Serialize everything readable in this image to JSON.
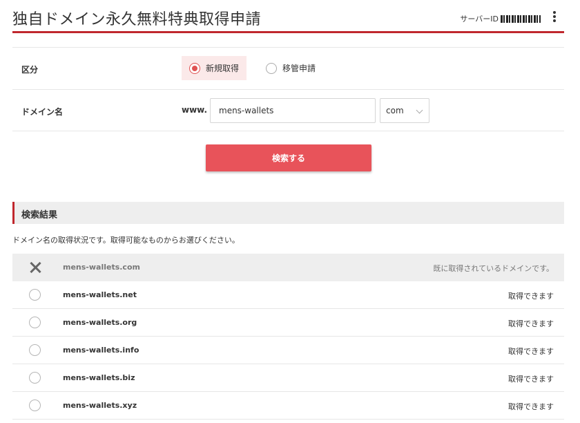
{
  "header": {
    "title": "独自ドメイン永久無料特典取得申請",
    "server_id_label": "サーバーID"
  },
  "form": {
    "type_label": "区分",
    "type_options": [
      {
        "label": "新規取得",
        "selected": true
      },
      {
        "label": "移管申請",
        "selected": false
      }
    ],
    "domain_label": "ドメイン名",
    "www_prefix": "www.",
    "domain_value": "mens-wallets",
    "tld_value": "com",
    "search_button": "検索する"
  },
  "results": {
    "title": "検索結果",
    "note": "ドメイン名の取得状況です。取得可能なものからお選びください。",
    "items": [
      {
        "domain": "mens-wallets.com",
        "status": "既に取得されているドメインです。",
        "available": false
      },
      {
        "domain": "mens-wallets.net",
        "status": "取得できます",
        "available": true
      },
      {
        "domain": "mens-wallets.org",
        "status": "取得できます",
        "available": true
      },
      {
        "domain": "mens-wallets.info",
        "status": "取得できます",
        "available": true
      },
      {
        "domain": "mens-wallets.biz",
        "status": "取得できます",
        "available": true
      },
      {
        "domain": "mens-wallets.xyz",
        "status": "取得できます",
        "available": true
      }
    ]
  },
  "colors": {
    "accent": "#c0272d",
    "button": "#e8535a"
  }
}
